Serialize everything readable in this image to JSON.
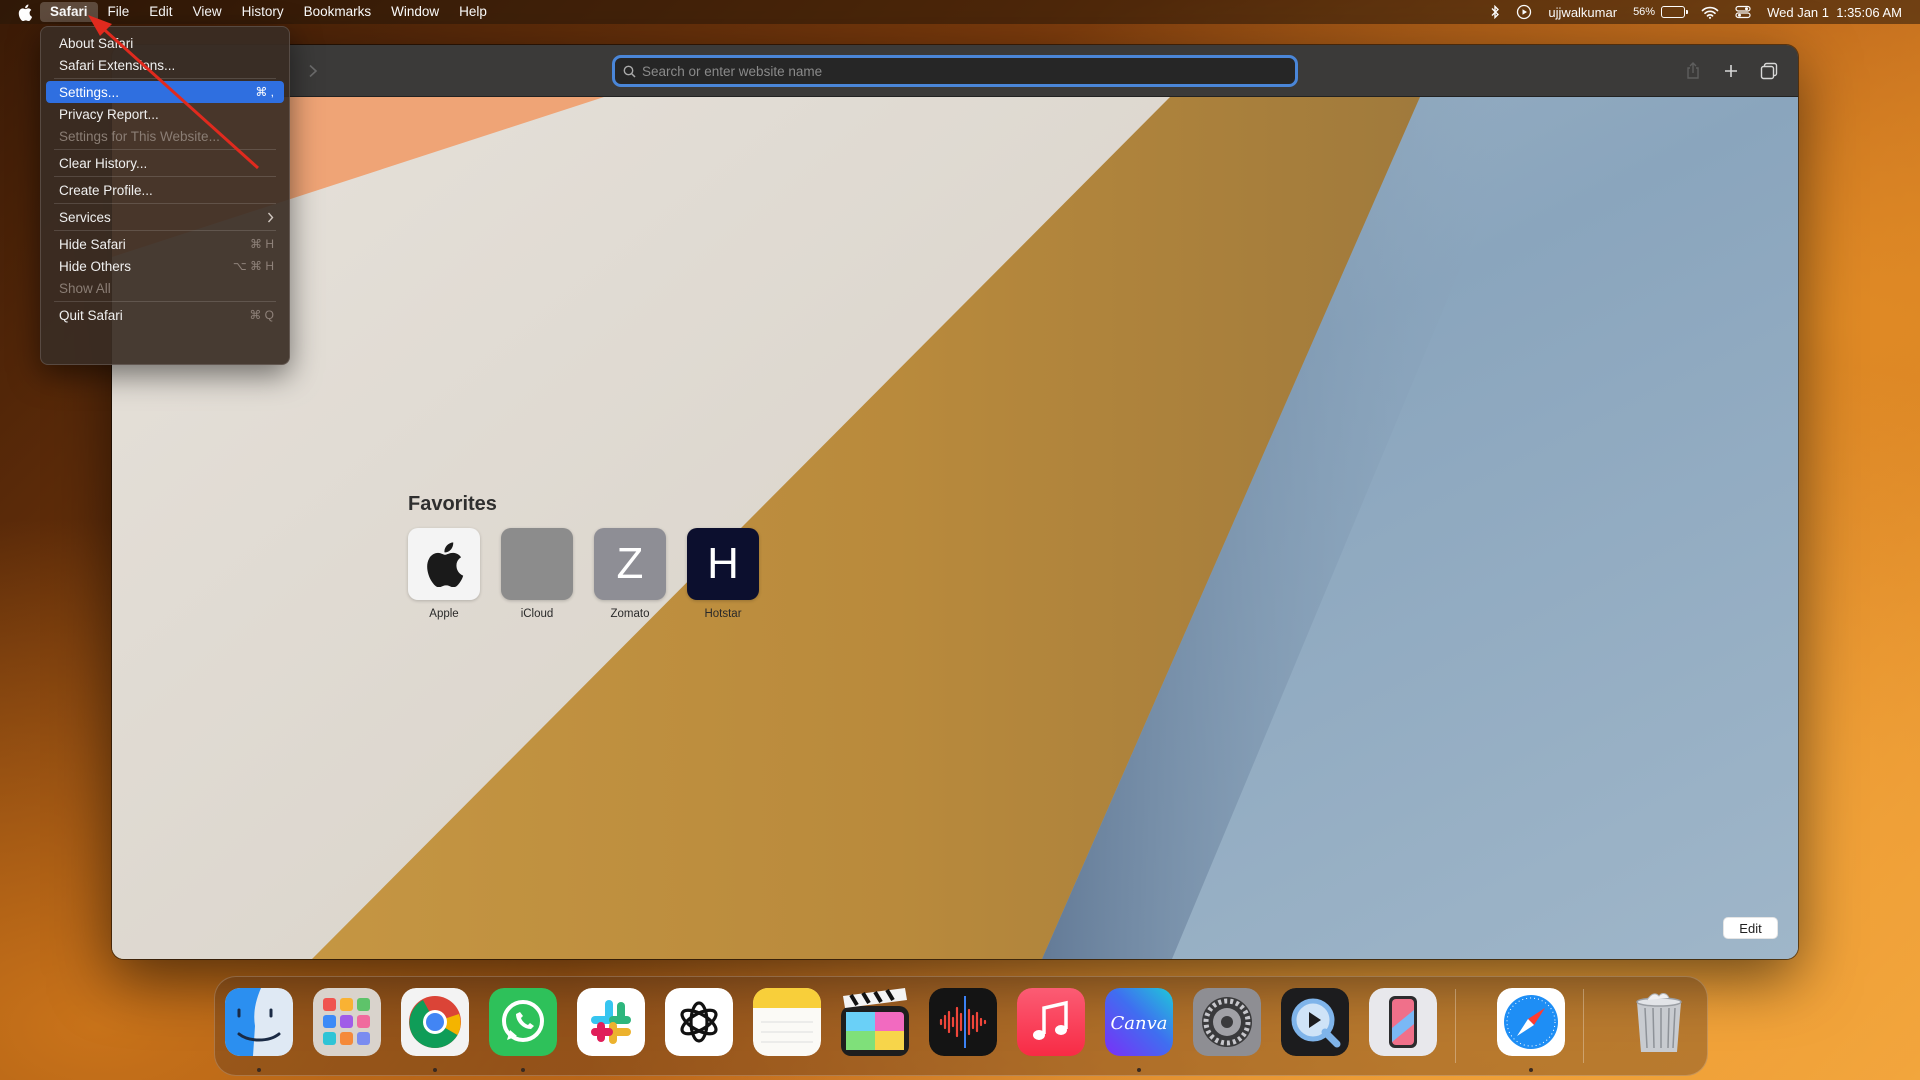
{
  "menubar": {
    "apple_icon": "apple-logo-icon",
    "items": [
      {
        "label": "Safari"
      },
      {
        "label": "File"
      },
      {
        "label": "Edit"
      },
      {
        "label": "View"
      },
      {
        "label": "History"
      },
      {
        "label": "Bookmarks"
      },
      {
        "label": "Window"
      },
      {
        "label": "Help"
      }
    ],
    "status": {
      "bluetooth_icon": "bluetooth-icon",
      "media_icon": "play-circle-icon",
      "user": "ujjwalkumar",
      "battery_percent": "56%",
      "battery_level": 0.56,
      "wifi_icon": "wifi-icon",
      "control_center_icon": "control-center-icon",
      "datetime": "Wed Jan 1  1:35:06 AM"
    }
  },
  "safari_menu": {
    "about": "About Safari",
    "extensions": "Safari Extensions...",
    "settings": "Settings...",
    "settings_shortcut": "⌘ ,",
    "privacy": "Privacy Report...",
    "settings_website": "Settings for This Website...",
    "clear_history": "Clear History...",
    "create_profile": "Create Profile...",
    "services": "Services",
    "hide_safari": "Hide Safari",
    "hide_safari_shortcut": "⌘ H",
    "hide_others": "Hide Others",
    "hide_others_shortcut": "⌥ ⌘ H",
    "show_all": "Show All",
    "quit": "Quit Safari",
    "quit_shortcut": "⌘ Q"
  },
  "toolbar": {
    "search_placeholder": "Search or enter website name"
  },
  "favorites": {
    "title": "Favorites",
    "items": [
      {
        "label": "Apple",
        "glyph": "",
        "color": "#f4f4f4"
      },
      {
        "label": "iCloud",
        "glyph": "",
        "color": "#8c8c8c"
      },
      {
        "label": "Zomato",
        "glyph": "Z",
        "color": "#8e8e95"
      },
      {
        "label": "Hotstar",
        "glyph": "H",
        "color": "#0c0f2e"
      }
    ]
  },
  "edit_label": "Edit",
  "dock": {
    "apps": [
      "Finder",
      "Launchpad",
      "Google Chrome",
      "WhatsApp",
      "Slack",
      "ChatGPT",
      "Notes",
      "Final Cut Pro",
      "Voice Memos",
      "Music",
      "Canva",
      "System Settings",
      "QuickTime Player",
      "iPhone Mirroring",
      "Safari",
      "Trash"
    ],
    "canva_label": "Canva"
  },
  "colors": {
    "menu_highlight": "#2f6fe0",
    "address_focus": "#4a86d8"
  }
}
